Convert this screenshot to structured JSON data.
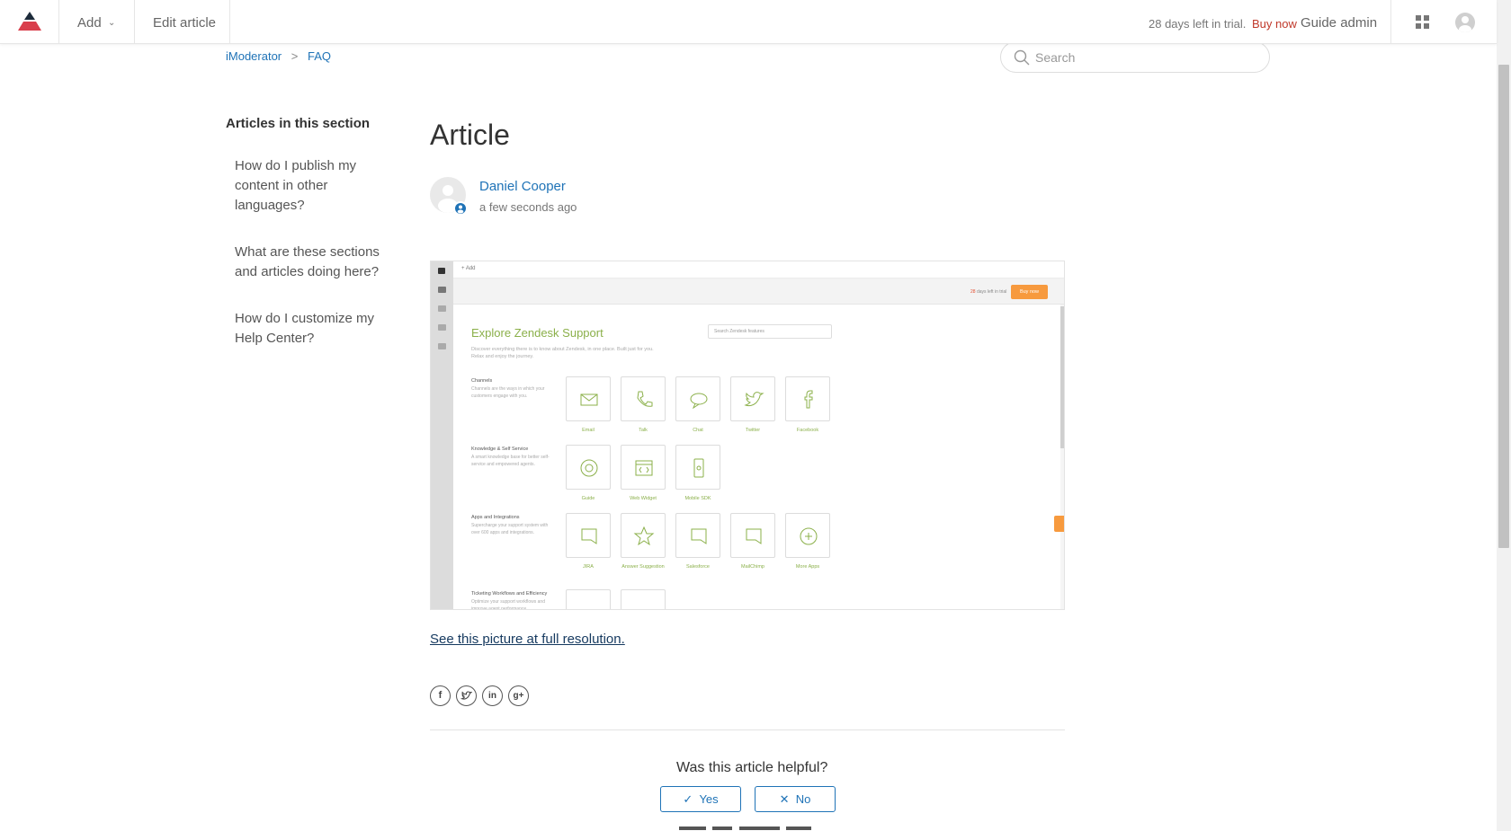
{
  "topbar": {
    "add_label": "Add",
    "edit_label": "Edit article",
    "trial_text": "28 days left in trial.",
    "buy_label": "Buy now",
    "user_label": "Guide admin"
  },
  "breadcrumb": {
    "items": [
      "iModerator",
      "FAQ"
    ],
    "separator": ">"
  },
  "search": {
    "placeholder": "Search"
  },
  "sidebar": {
    "title": "Articles in this section",
    "items": [
      "How do I publish my content in other languages?",
      "What are these sections and articles doing here?",
      "How do I customize my Help Center?"
    ]
  },
  "article": {
    "title": "Article",
    "author": "Daniel Cooper",
    "time": "a few seconds ago",
    "fullres_link": "See this picture at full resolution."
  },
  "embedded": {
    "add": "+ Add",
    "trial_days": "28",
    "trial_suffix": "days left in trial",
    "buy": "Buy now",
    "heading": "Explore Zendesk Support",
    "description": "Discover everything there is to know about Zendesk, in one place. Built just for you. Relax and enjoy the journey.",
    "search_placeholder": "Search Zendesk features",
    "categories": [
      {
        "title": "Channels",
        "desc": "Channels are the ways in which your customers engage with you."
      },
      {
        "title": "Knowledge & Self Service",
        "desc": "A smart knowledge base for better self-service and empowered agents."
      },
      {
        "title": "Apps and Integrations",
        "desc": "Supercharge your support system with over 600 apps and integrations."
      },
      {
        "title": "Ticketing Workflows and Efficiency",
        "desc": "Optimize your support workflows and improve agent performance."
      }
    ],
    "channels": [
      "Email",
      "Talk",
      "Chat",
      "Twitter",
      "Facebook"
    ],
    "knowledge": [
      "Guide",
      "Web Widget",
      "Mobile SDK"
    ],
    "apps": [
      "JIRA",
      "Answer Suggestion",
      "Salesforce",
      "MailChimp",
      "More Apps"
    ]
  },
  "share": {
    "icons": [
      "facebook-icon",
      "twitter-icon",
      "linkedin-icon",
      "googleplus-icon"
    ]
  },
  "feedback": {
    "question": "Was this article helpful?",
    "yes": "Yes",
    "no": "No"
  },
  "colors": {
    "link": "#1f73b7",
    "buy_now": "#c0392b",
    "logo_red": "#d93f4c",
    "zendesk_green": "#8bb04a",
    "zendesk_orange": "#f79a3e"
  }
}
